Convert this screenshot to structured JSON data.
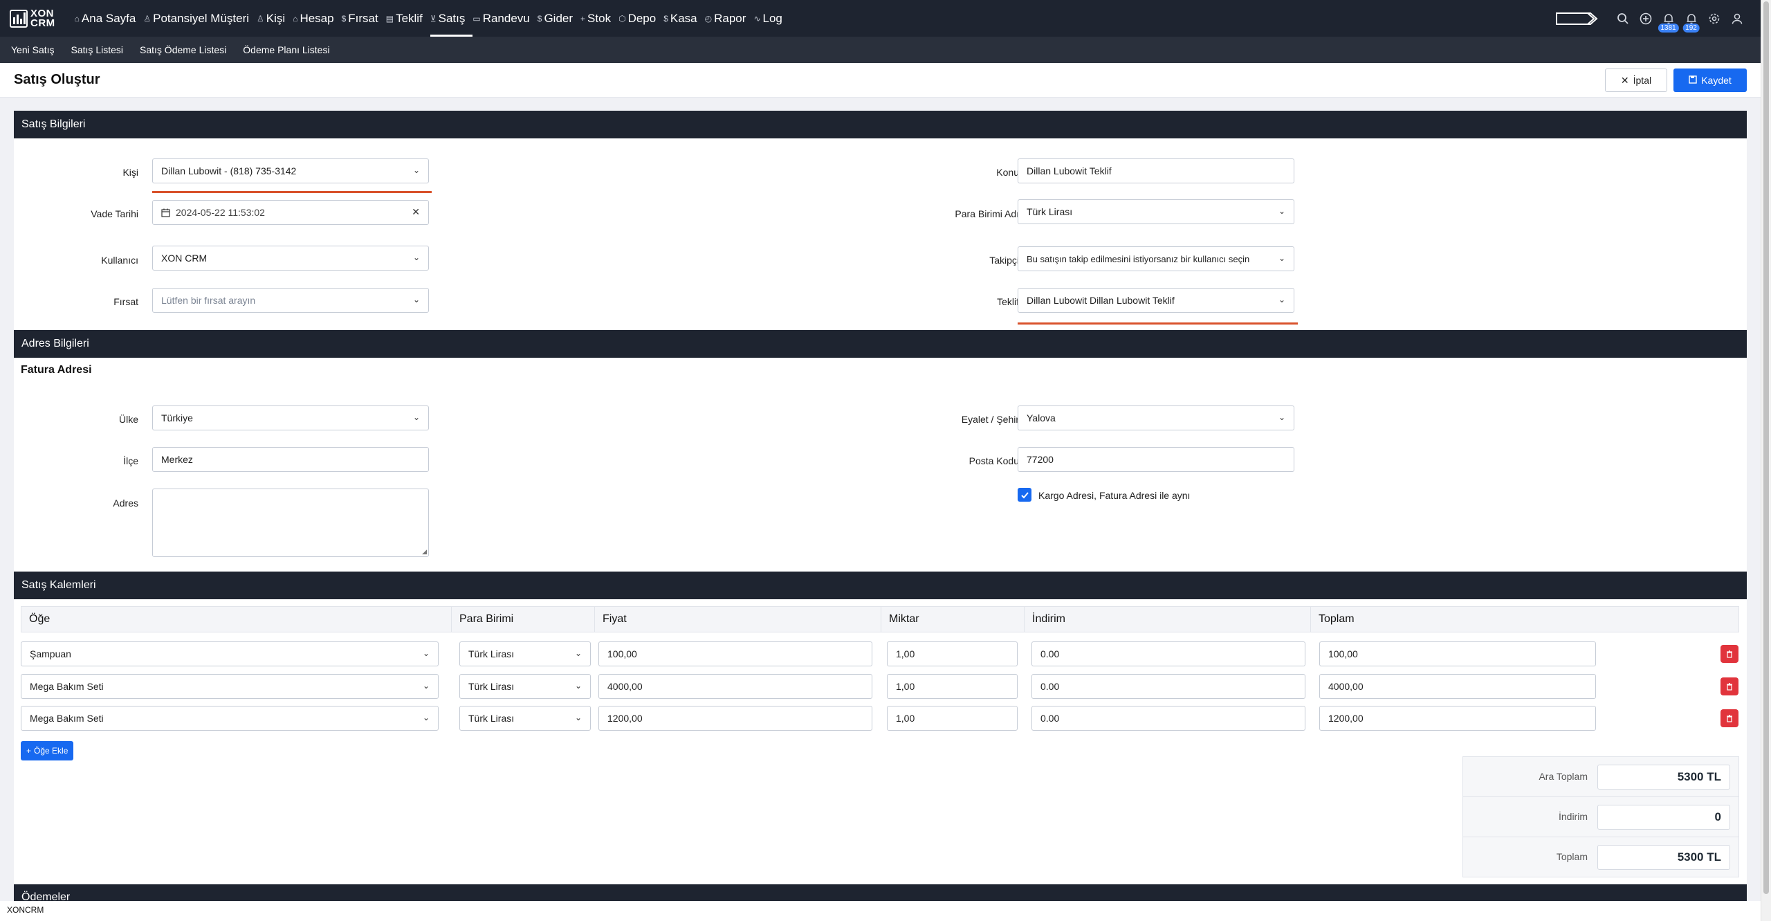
{
  "app": {
    "logo_text_line1": "XON",
    "logo_text_line2": "CRM"
  },
  "nav": {
    "items": [
      {
        "icon": "⌂",
        "label": "Ana Sayfa"
      },
      {
        "icon": "♙",
        "label": "Potansiyel Müşteri"
      },
      {
        "icon": "♙",
        "label": "Kişi"
      },
      {
        "icon": "⌂",
        "label": "Hesap"
      },
      {
        "icon": "$",
        "label": "Fırsat"
      },
      {
        "icon": "▤",
        "label": "Teklif"
      },
      {
        "icon": "⊻",
        "label": "Satış"
      },
      {
        "icon": "▭",
        "label": "Randevu"
      },
      {
        "icon": "$",
        "label": "Gider"
      },
      {
        "icon": "+",
        "label": "Stok"
      },
      {
        "icon": "⬡",
        "label": "Depo"
      },
      {
        "icon": "$",
        "label": "Kasa"
      },
      {
        "icon": "◴",
        "label": "Rapor"
      },
      {
        "icon": "∿",
        "label": "Log"
      }
    ],
    "active_index": 6,
    "badges": {
      "notifications": "1381",
      "alerts": "192"
    }
  },
  "subnav": {
    "items": [
      "Yeni Satış",
      "Satış Listesi",
      "Satış Ödeme Listesi",
      "Ödeme Planı Listesi"
    ]
  },
  "page": {
    "title": "Satış Oluştur",
    "cancel_label": "İptal",
    "save_label": "Kaydet"
  },
  "sales_info": {
    "header": "Satış Bilgileri",
    "kisi_label": "Kişi",
    "kisi_value": "Dillan Lubowit - (818) 735-3142",
    "vade_label": "Vade Tarihi",
    "vade_value": "2024-05-22 11:53:02",
    "kullanici_label": "Kullanıcı",
    "kullanici_value": "XON CRM",
    "firsat_label": "Fırsat",
    "firsat_placeholder": "Lütfen bir fırsat arayın",
    "konu_label": "Konu",
    "konu_value": "Dillan Lubowit Teklif",
    "para_label": "Para Birimi Adı",
    "para_value": "Türk Lirası",
    "takipci_label": "Takipçi",
    "takipci_value": "Bu satışın takip edilmesini istiyorsanız bir kullanıcı seçin",
    "teklif_label": "Teklif",
    "teklif_value": "Dillan Lubowit Dillan Lubowit Teklif"
  },
  "address": {
    "header": "Adres Bilgileri",
    "subtitle": "Fatura Adresi",
    "ulke_label": "Ülke",
    "ulke_value": "Türkiye",
    "ilce_label": "İlçe",
    "ilce_value": "Merkez",
    "adres_label": "Adres",
    "adres_value": "",
    "eyalet_label": "Eyalet / Şehir",
    "eyalet_value": "Yalova",
    "posta_label": "Posta Kodu",
    "posta_value": "77200",
    "kargo_label": "Kargo Adresi, Fatura Adresi ile aynı",
    "kargo_checked": true
  },
  "items": {
    "header": "Satış Kalemleri",
    "columns": [
      "Öğe",
      "Para Birimi",
      "Fiyat",
      "Miktar",
      "İndirim",
      "Toplam"
    ],
    "rows": [
      {
        "item": "Şampuan",
        "currency": "Türk Lirası",
        "price": "100,00",
        "qty": "1,00",
        "discount": "0.00",
        "total": "100,00"
      },
      {
        "item": "Mega Bakım Seti",
        "currency": "Türk Lirası",
        "price": "4000,00",
        "qty": "1,00",
        "discount": "0.00",
        "total": "4000,00"
      },
      {
        "item": "Mega Bakım Seti",
        "currency": "Türk Lirası",
        "price": "1200,00",
        "qty": "1,00",
        "discount": "0.00",
        "total": "1200,00"
      }
    ],
    "add_label": "Öğe Ekle"
  },
  "totals": {
    "subtotal_label": "Ara Toplam",
    "subtotal_value": "5300 TL",
    "discount_label": "İndirim",
    "discount_value": "0",
    "total_label": "Toplam",
    "total_value": "5300 TL"
  },
  "payments": {
    "header": "Ödemeler"
  },
  "footer": {
    "text": "XONCRM"
  },
  "colors": {
    "nav_bg": "#1e2430",
    "accent": "#1769f0",
    "danger": "#e1343c",
    "highlight": "#d9522b"
  }
}
